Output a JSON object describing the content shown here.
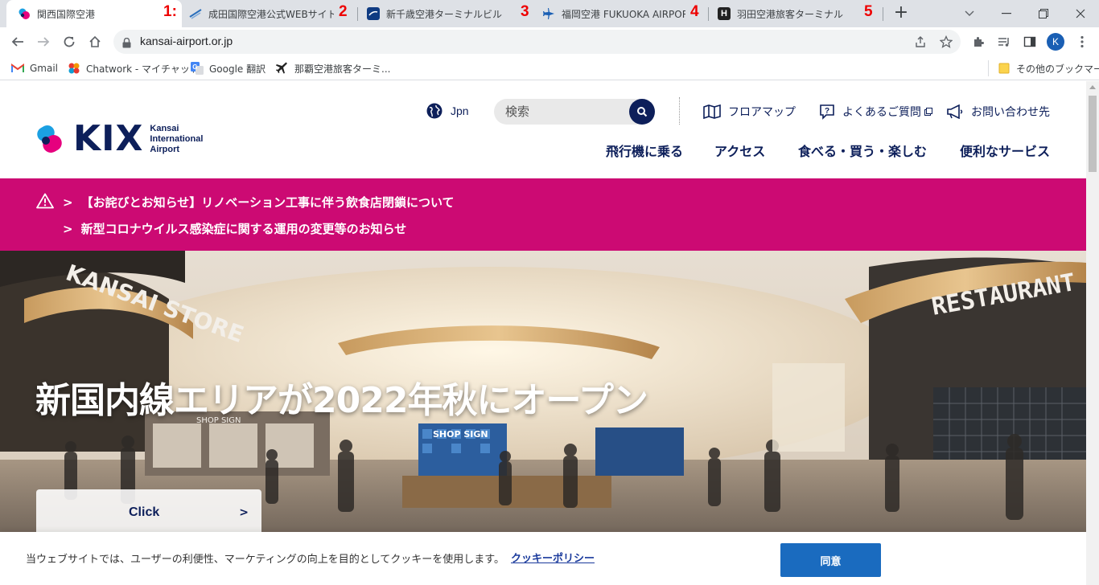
{
  "browser": {
    "tabs": [
      {
        "title": "関西国際空港",
        "annotation": "1:",
        "active": true
      },
      {
        "title": "成田国際空港公式WEBサイト",
        "annotation": "2"
      },
      {
        "title": "新千歳空港ターミナルビル",
        "annotation": "3"
      },
      {
        "title": "福岡空港 FUKUOKA AIRPORT",
        "annotation": "4"
      },
      {
        "title": "羽田空港旅客ターミナル",
        "annotation": "5"
      }
    ],
    "new_tab_label": "+",
    "url": "kansai-airport.or.jp",
    "profile_initial": "K",
    "bookmarks": [
      {
        "label": "Gmail",
        "icon": "gmail-icon"
      },
      {
        "label": "Chatwork - マイチャット",
        "icon": "chatwork-icon"
      },
      {
        "label": "Google 翻訳",
        "icon": "google-translate-icon"
      },
      {
        "label": "那覇空港旅客ターミ...",
        "icon": "airplane-icon"
      }
    ],
    "other_bookmarks": "その他のブックマーク"
  },
  "site": {
    "logo_text": "KIX",
    "logo_sub": [
      "Kansai",
      "International",
      "Airport"
    ],
    "lang_label": "Jpn",
    "search_placeholder": "検索",
    "utility_links": [
      {
        "label": "フロアマップ",
        "icon": "map-icon"
      },
      {
        "label": "よくあるご質問",
        "icon": "question-icon"
      },
      {
        "label": "お問い合わせ先",
        "icon": "megaphone-icon"
      }
    ],
    "main_nav": [
      "飛行機に乗る",
      "アクセス",
      "食べる・買う・楽しむ",
      "便利なサービス"
    ],
    "alerts": [
      "【お詫びとお知らせ】リノベーション工事に伴う飲食店閉鎖について",
      "新型コロナウイルス感染症に関する運用の変更等のお知らせ"
    ],
    "alert_chevron": ">",
    "hero": {
      "title": "新国内線エリアが2022年秋にオープン",
      "sign_left": "KANSAI STORE",
      "sign_right": "RESTAURANT",
      "shop_sign": "SHOP SIGN",
      "button_label": "Click",
      "button_chevron": ">"
    },
    "cookie": {
      "message": "当ウェブサイトでは、ユーザーの利便性、マーケティングの向上を目的としてクッキーを使用します。",
      "policy_link": "クッキーポリシー",
      "agree_button": "同意"
    }
  },
  "colors": {
    "brand_navy": "#0d1f5a",
    "alert_magenta": "#cc0a73",
    "agree_blue": "#1a6bbf",
    "tab_number_red": "#e00000"
  }
}
